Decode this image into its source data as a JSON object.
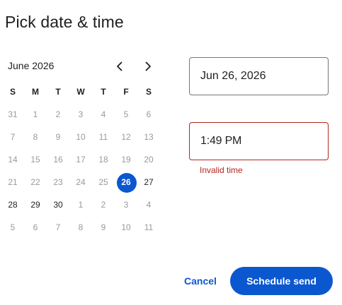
{
  "dialog": {
    "title": "Pick date & time"
  },
  "calendar": {
    "month_label": "June 2026",
    "prev_icon": "chevron-left-icon",
    "next_icon": "chevron-right-icon",
    "weekdays": [
      "S",
      "M",
      "T",
      "W",
      "T",
      "F",
      "S"
    ],
    "weeks": [
      [
        {
          "d": "31",
          "m": true
        },
        {
          "d": "1",
          "m": true
        },
        {
          "d": "2",
          "m": true
        },
        {
          "d": "3",
          "m": true
        },
        {
          "d": "4",
          "m": true
        },
        {
          "d": "5",
          "m": true
        },
        {
          "d": "6",
          "m": true
        }
      ],
      [
        {
          "d": "7",
          "m": true
        },
        {
          "d": "8",
          "m": true
        },
        {
          "d": "9",
          "m": true
        },
        {
          "d": "10",
          "m": true
        },
        {
          "d": "11",
          "m": true
        },
        {
          "d": "12",
          "m": true
        },
        {
          "d": "13",
          "m": true
        }
      ],
      [
        {
          "d": "14",
          "m": true
        },
        {
          "d": "15",
          "m": true
        },
        {
          "d": "16",
          "m": true
        },
        {
          "d": "17",
          "m": true
        },
        {
          "d": "18",
          "m": true
        },
        {
          "d": "19",
          "m": true
        },
        {
          "d": "20",
          "m": true
        }
      ],
      [
        {
          "d": "21",
          "m": true
        },
        {
          "d": "22",
          "m": true
        },
        {
          "d": "23",
          "m": true
        },
        {
          "d": "24",
          "m": true
        },
        {
          "d": "25",
          "m": true
        },
        {
          "d": "26",
          "s": true
        },
        {
          "d": "27"
        }
      ],
      [
        {
          "d": "28"
        },
        {
          "d": "29"
        },
        {
          "d": "30"
        },
        {
          "d": "1",
          "m": true
        },
        {
          "d": "2",
          "m": true
        },
        {
          "d": "3",
          "m": true
        },
        {
          "d": "4",
          "m": true
        }
      ],
      [
        {
          "d": "5",
          "m": true
        },
        {
          "d": "6",
          "m": true
        },
        {
          "d": "7",
          "m": true
        },
        {
          "d": "8",
          "m": true
        },
        {
          "d": "9",
          "m": true
        },
        {
          "d": "10",
          "m": true
        },
        {
          "d": "11",
          "m": true
        }
      ]
    ],
    "selected_day": "26"
  },
  "date_field": {
    "value": "Jun 26, 2026"
  },
  "time_field": {
    "value": "1:49 PM",
    "error": "Invalid time"
  },
  "actions": {
    "cancel_label": "Cancel",
    "schedule_label": "Schedule send"
  },
  "colors": {
    "accent": "#0b57d0",
    "error": "#b3261e",
    "muted_text": "#9a9a9a"
  }
}
